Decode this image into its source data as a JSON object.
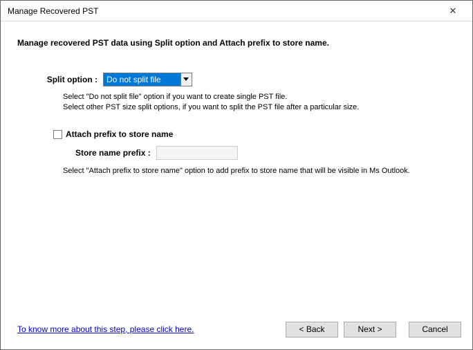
{
  "titlebar": {
    "title": "Manage Recovered PST",
    "close_glyph": "✕"
  },
  "heading": "Manage recovered PST data using Split option and Attach prefix to store name.",
  "split": {
    "label": "Split option :",
    "value": "Do not split file",
    "help_line1": "Select \"Do not split file\" option if you want to create single PST file.",
    "help_line2": "Select other PST size split options, if you want to split the PST file after a particular size."
  },
  "attach": {
    "checkbox_label": "Attach prefix to store name",
    "prefix_label": "Store name prefix :",
    "prefix_value": "",
    "help": "Select \"Attach prefix to store name\" option to add prefix to store name that will be visible in Ms Outlook."
  },
  "footer": {
    "help_link": "To know more about this step, please click here.",
    "back": "< Back",
    "next": "Next >",
    "cancel": "Cancel"
  }
}
